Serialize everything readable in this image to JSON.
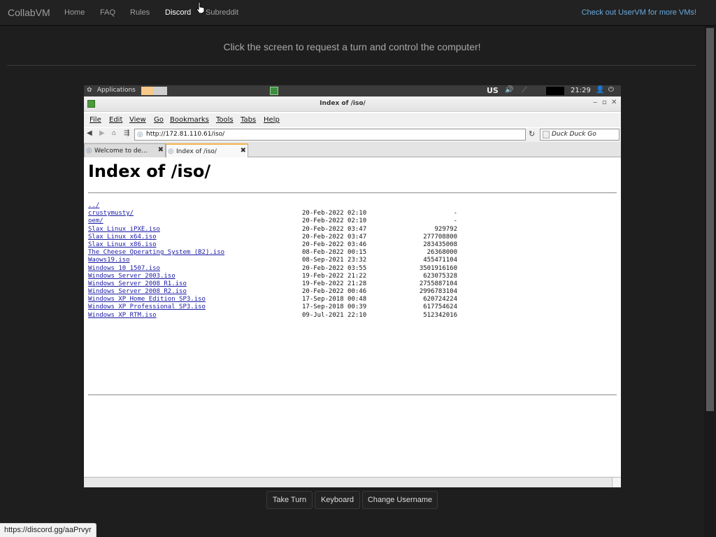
{
  "navbar": {
    "brand": "CollabVM",
    "links": [
      "Home",
      "FAQ",
      "Rules",
      "Discord",
      "Subreddit"
    ],
    "active": "Discord",
    "right_link": "Check out UserVM for more VMs!"
  },
  "prompt": "Click the screen to request a turn and control the computer!",
  "vm": {
    "panel": {
      "applications": "Applications",
      "keyboard_layout": "US",
      "clock": "21:29"
    },
    "window_title": "Index of /iso/",
    "menu": [
      "File",
      "Edit",
      "View",
      "Go",
      "Bookmarks",
      "Tools",
      "Tabs",
      "Help"
    ],
    "url": "http://172.81.110.61/iso/",
    "search_placeholder": "Duck Duck Go",
    "tabs": [
      {
        "label": "Welcome to de...",
        "active": false
      },
      {
        "label": "Index of /iso/",
        "active": true
      }
    ],
    "page_heading": "Index of /iso/",
    "listing": [
      {
        "name": "../",
        "date": "",
        "size": ""
      },
      {
        "name": "crustymusty/",
        "date": "20-Feb-2022 02:10",
        "size": "-"
      },
      {
        "name": "oem/",
        "date": "20-Feb-2022 02:10",
        "size": "-"
      },
      {
        "name": "Slax Linux iPXE.iso",
        "date": "20-Feb-2022 03:47",
        "size": "929792"
      },
      {
        "name": "Slax Linux x64.iso",
        "date": "20-Feb-2022 03:47",
        "size": "277708800"
      },
      {
        "name": "Slax Linux x86.iso",
        "date": "20-Feb-2022 03:46",
        "size": "283435008"
      },
      {
        "name": "The Cheese Operating System (B2).iso",
        "date": "08-Feb-2022 00:15",
        "size": "26368000"
      },
      {
        "name": "Waows19.iso",
        "date": "08-Sep-2021 23:32",
        "size": "455471104"
      },
      {
        "name": "Windows 10 1507.iso",
        "date": "20-Feb-2022 03:55",
        "size": "3501916160"
      },
      {
        "name": "Windows Server 2003.iso",
        "date": "19-Feb-2022 21:22",
        "size": "623075328"
      },
      {
        "name": "Windows Server 2008 R1.iso",
        "date": "19-Feb-2022 21:28",
        "size": "2755887104"
      },
      {
        "name": "Windows Server 2008 R2.iso",
        "date": "20-Feb-2022 00:46",
        "size": "2996783104"
      },
      {
        "name": "Windows XP Home Edition SP3.iso",
        "date": "17-Sep-2018 00:48",
        "size": "620724224"
      },
      {
        "name": "Windows XP Professional SP3.iso",
        "date": "17-Sep-2018 00:39",
        "size": "617754624"
      },
      {
        "name": "Windows XP RTM.iso",
        "date": "09-Jul-2021 22:10",
        "size": "512342016"
      }
    ]
  },
  "buttons": {
    "take_turn": "Take Turn",
    "keyboard": "Keyboard",
    "change_username": "Change Username"
  },
  "status_url": "https://discord.gg/aaPrvyr"
}
